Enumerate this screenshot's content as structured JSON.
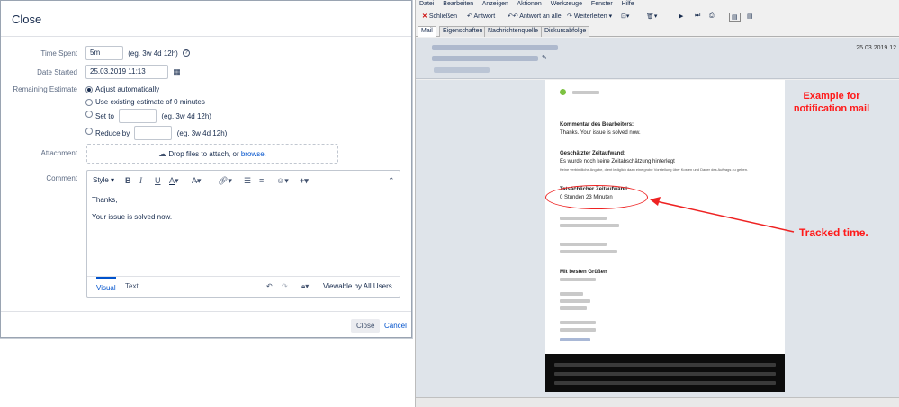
{
  "dialog": {
    "title": "Close",
    "time_spent": {
      "label": "Time Spent",
      "value": "5m",
      "hint": "(eg. 3w 4d 12h)"
    },
    "date_started": {
      "label": "Date Started",
      "value": "25.03.2019 11:13"
    },
    "remaining": {
      "label": "Remaining Estimate",
      "options": [
        {
          "label": "Adjust automatically",
          "selected": true
        },
        {
          "label": "Use existing estimate of 0 minutes",
          "selected": false
        },
        {
          "label": "Set to",
          "hint": "(eg. 3w 4d 12h)",
          "selected": false
        },
        {
          "label": "Reduce by",
          "hint": "(eg. 3w 4d 12h)",
          "selected": false
        }
      ]
    },
    "attachment": {
      "label": "Attachment",
      "text": "Drop files to attach, or",
      "link": "browse."
    },
    "comment": {
      "label": "Comment",
      "toolbar": {
        "style": "Style"
      },
      "lines": [
        "Thanks,",
        "Your issue is solved now."
      ],
      "tab_visual": "Visual",
      "tab_text": "Text",
      "visibility": "Viewable by All Users"
    },
    "buttons": {
      "close": "Close",
      "cancel": "Cancel"
    }
  },
  "mail": {
    "menu": [
      "Datei",
      "Bearbeiten",
      "Anzeigen",
      "Aktionen",
      "Werkzeuge",
      "Fenster",
      "Hilfe"
    ],
    "toolbar": {
      "close": "Schließen",
      "reply": "Antwort",
      "reply_all": "Antwort an alle",
      "forward": "Weiterleiten"
    },
    "tabs": [
      "Mail",
      "Eigenschaften",
      "Nachrichtenquelle",
      "Diskursabfolge"
    ],
    "date": "25.03.2019 12",
    "body": {
      "comment_title": "Kommentar des Bearbeiters:",
      "comment_text": "Thanks. Your issue is solved now.",
      "estimate_title": "Geschätzter Zeitaufwand:",
      "estimate_text": "Es wurde noch keine Zeitabschätzung hinterlegt",
      "estimate_small": "Keine verbindliche Angabe, dient lediglich dazu eine grobe Vorstellung über Kosten und Dauer des Auftrags zu geben.",
      "actual_title": "Tatsächlicher Zeitaufwand:",
      "actual_text": "0 Stunden 23 Minuten",
      "greeting": "Mit besten Grüßen"
    }
  },
  "annotations": {
    "example_line1": "Example for",
    "example_line2": "notification mail",
    "tracked": "Tracked time."
  },
  "colors": {
    "annotation": "#ff1a1a",
    "link": "#0052cc",
    "green_dot": "#7dc242"
  }
}
